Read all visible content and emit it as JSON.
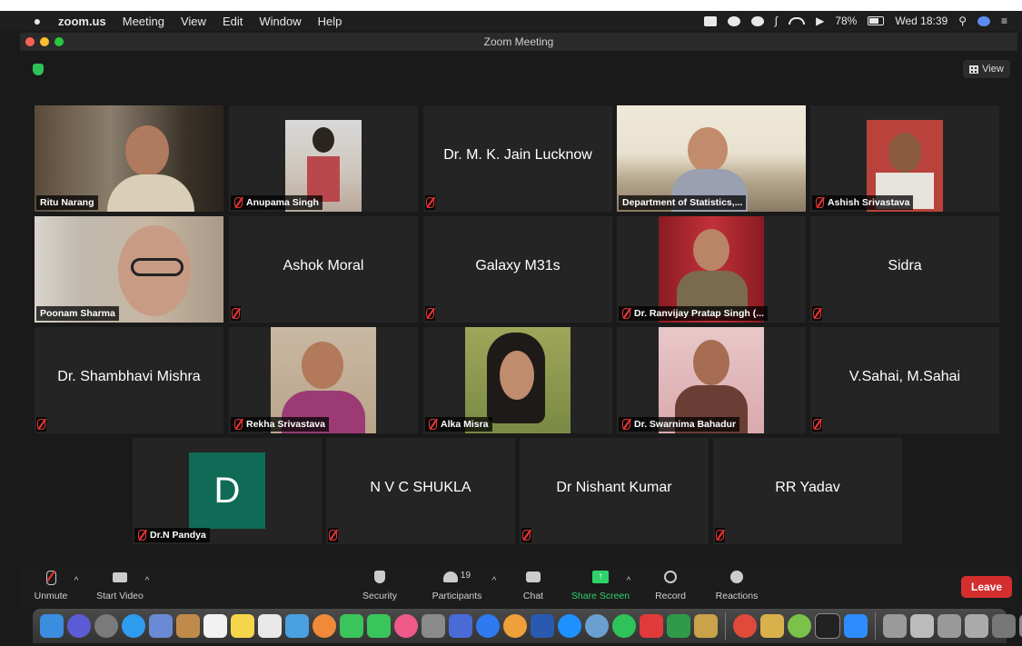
{
  "menubar": {
    "app": "zoom.us",
    "items": [
      "Meeting",
      "View",
      "Edit",
      "Window",
      "Help"
    ],
    "battery": "78%",
    "clock": "Wed 18:39"
  },
  "window": {
    "title": "Zoom Meeting",
    "view_label": "View"
  },
  "participants": [
    {
      "name": "Ritu Narang",
      "kind": "video",
      "active": true,
      "muted": false
    },
    {
      "name": "Anupama Singh",
      "kind": "photo",
      "muted": true
    },
    {
      "name": "Dr. M. K. Jain Lucknow",
      "kind": "name",
      "muted": true
    },
    {
      "name": "Department of Statistics,...",
      "kind": "video",
      "muted": false
    },
    {
      "name": "Ashish Srivastava",
      "kind": "photo",
      "muted": true
    },
    {
      "name": "Poonam Sharma",
      "kind": "video",
      "muted": false
    },
    {
      "name": "Ashok Moral",
      "kind": "name",
      "muted": true
    },
    {
      "name": "Galaxy M31s",
      "kind": "name",
      "muted": true
    },
    {
      "name": "Dr. Ranvijay Pratap Singh (...",
      "kind": "photo",
      "muted": true
    },
    {
      "name": "Sidra",
      "kind": "name",
      "muted": true
    },
    {
      "name": "Dr. Shambhavi Mishra",
      "kind": "name",
      "muted": true
    },
    {
      "name": "Rekha Srivastava",
      "kind": "photo",
      "muted": true
    },
    {
      "name": "Alka Misra",
      "kind": "photo",
      "muted": true
    },
    {
      "name": "Dr. Swarnima Bahadur",
      "kind": "photo",
      "muted": true
    },
    {
      "name": "V.Sahai, M.Sahai",
      "kind": "name",
      "muted": true
    },
    {
      "name": "Dr.N Pandya",
      "kind": "avatar",
      "initial": "D",
      "muted": true
    },
    {
      "name": "N V C SHUKLA",
      "kind": "name",
      "muted": true
    },
    {
      "name": "Dr Nishant Kumar",
      "kind": "name",
      "muted": true
    },
    {
      "name": "RR Yadav",
      "kind": "name",
      "muted": true
    }
  ],
  "toolbar": {
    "unmute": "Unmute",
    "start_video": "Start Video",
    "security": "Security",
    "participants": "Participants",
    "participants_count": "19",
    "chat": "Chat",
    "share_screen": "Share Screen",
    "record": "Record",
    "reactions": "Reactions",
    "leave": "Leave"
  },
  "colors": {
    "active_speaker": "#d7e36b",
    "share_green": "#2fd36b",
    "leave_red": "#d32f2f",
    "avatar_teal": "#0f6b56"
  }
}
